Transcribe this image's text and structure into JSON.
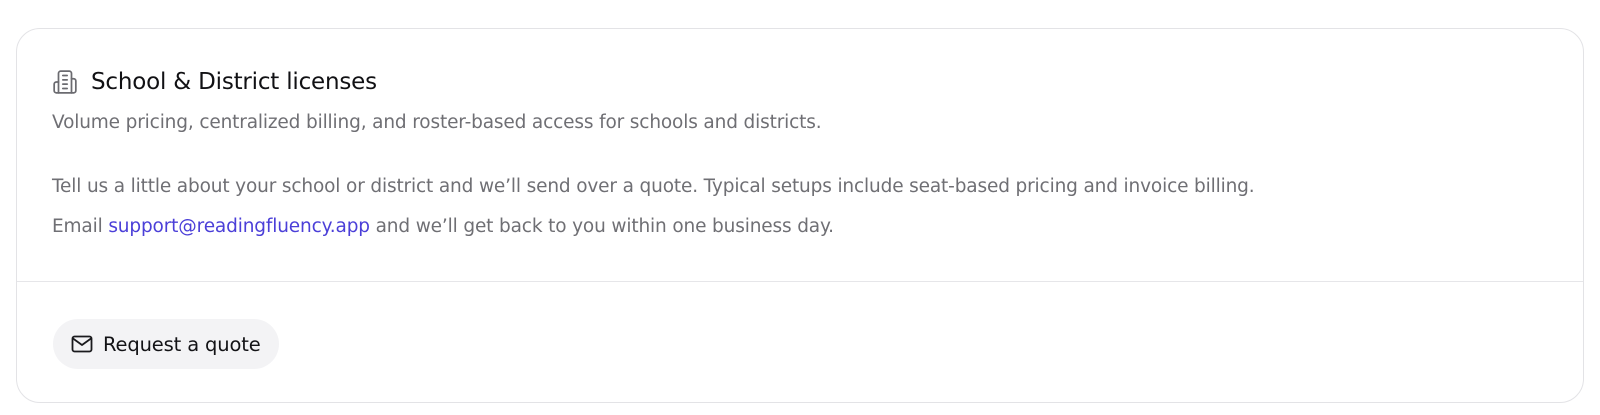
{
  "card": {
    "icon": "building-icon",
    "title": "School & District licenses",
    "subtitle": "Volume pricing, centralized billing, and roster-based access for schools and districts.",
    "paragraph_1": "Tell us a little about your school or district and we’ll send over a quote. Typical setups include seat-based pricing and invoice billing.",
    "paragraph_2_prefix": "Email ",
    "email": "support@readingfluency.app",
    "paragraph_2_suffix": " and we’ll get back to you within one business day."
  },
  "footer": {
    "button_icon": "mail-icon",
    "button_label": "Request a quote"
  },
  "colors": {
    "link": "#4b3fd8",
    "muted_text": "#6f6f74",
    "button_bg": "#f3f3f5",
    "border": "#e3e3e6"
  }
}
